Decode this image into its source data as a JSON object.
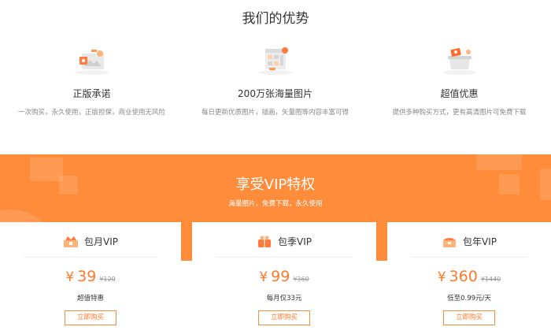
{
  "advantages": {
    "title": "我们的优势",
    "items": [
      {
        "title": "正版承诺",
        "desc": "一次购买，永久使用，正版担保，商业使用无风险",
        "icon": "certificate-icon"
      },
      {
        "title": "200万张海量图片",
        "desc": "每日更新优质图片，插画，矢量图等内容丰富可得",
        "icon": "image-library-icon"
      },
      {
        "title": "超值优惠",
        "desc": "提供多种购买方式，更有高清图片可免费下载",
        "icon": "discount-icon"
      }
    ]
  },
  "vip": {
    "title": "享受VIP特权",
    "subtitle": "海量图片，免费下载，永久使用",
    "accent": "#ff8c3b",
    "plans": [
      {
        "name": "包月VIP",
        "currency": "¥",
        "price": "39",
        "original": "¥120",
        "note": "超值特惠",
        "button": "立即购买",
        "icon": "crown-icon"
      },
      {
        "name": "包季VIP",
        "currency": "¥",
        "price": "99",
        "original": "¥360",
        "note": "每月仅33元",
        "button": "立即购买",
        "icon": "gift-icon"
      },
      {
        "name": "包年VIP",
        "currency": "¥",
        "price": "360",
        "original": "¥1440",
        "note": "低至0.99元/天",
        "button": "立即购买",
        "icon": "treasure-icon"
      }
    ]
  }
}
